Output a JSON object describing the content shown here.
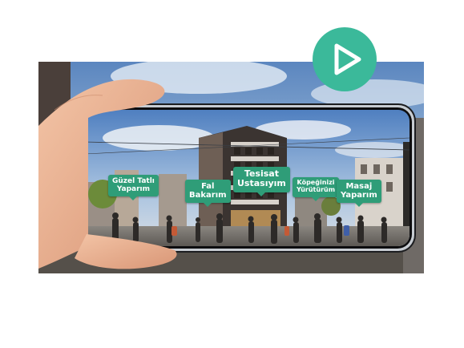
{
  "accent_color": "#3bb99a",
  "tag_color": "#2f9d78",
  "play_button": {
    "icon": "play-icon",
    "color": "#3bb99a"
  },
  "ar_tags": [
    {
      "line1": "Güzel Tatlı",
      "line2": "Yaparım"
    },
    {
      "line1": "Fal",
      "line2": "Bakarım"
    },
    {
      "line1": "Tesisat",
      "line2": "Ustasıyım"
    },
    {
      "line1": "Köpeğinizi",
      "line2": "Yürütürüm"
    },
    {
      "line1": "Masaj",
      "line2": "Yaparım"
    }
  ]
}
